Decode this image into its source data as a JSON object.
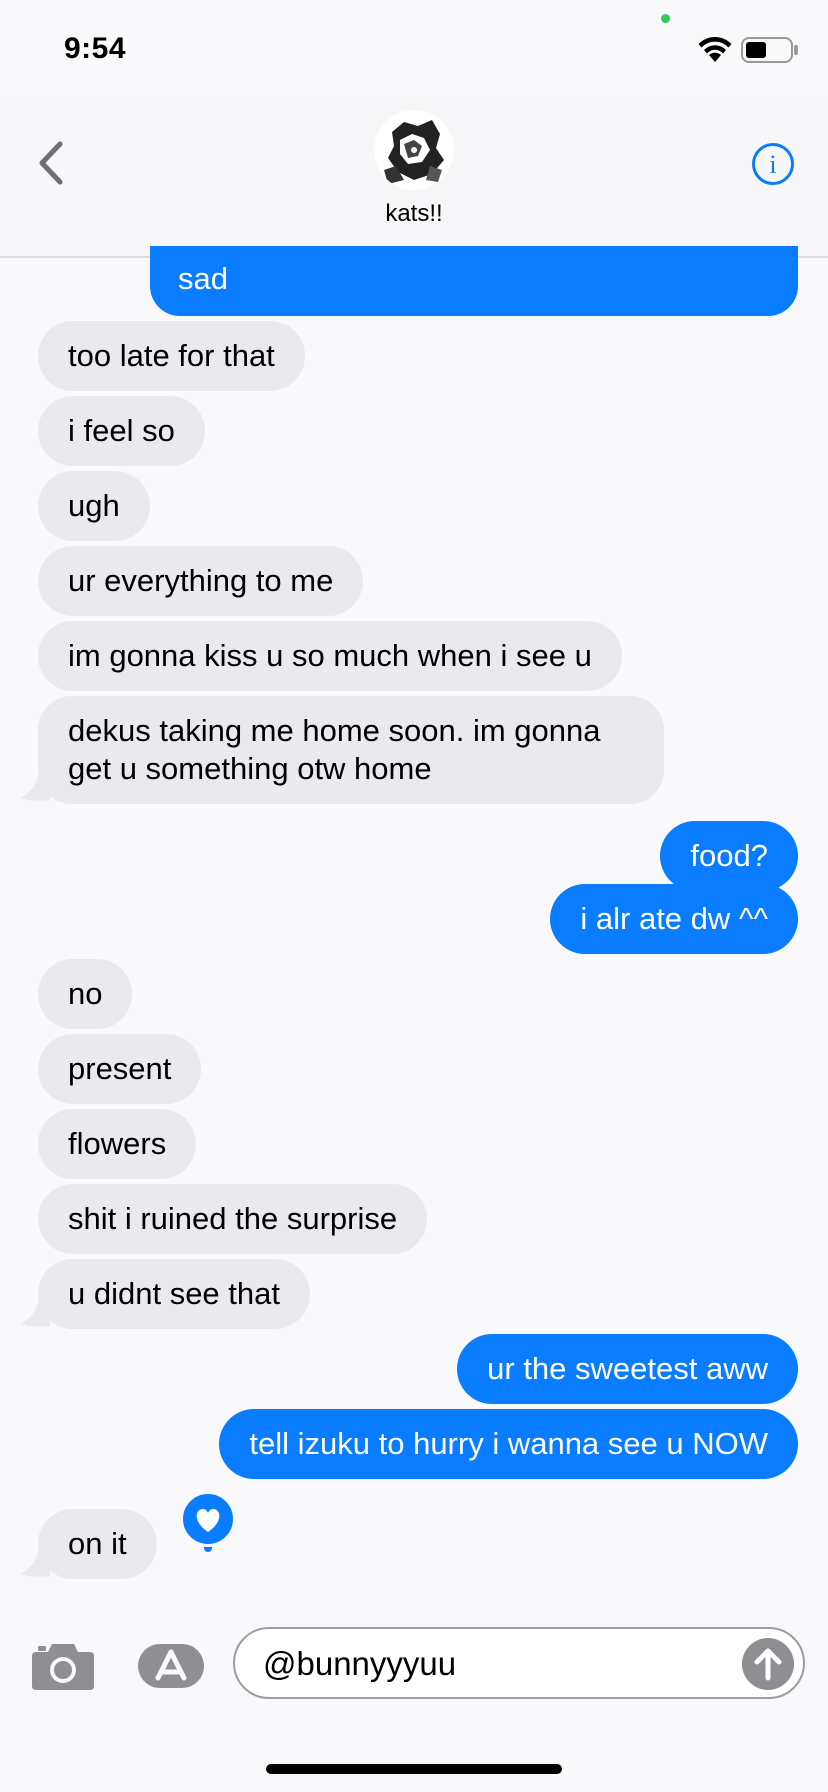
{
  "status_bar": {
    "time": "9:54",
    "camera_indicator_color": "#34c759",
    "icons": [
      "wifi-icon",
      "battery-icon"
    ]
  },
  "header": {
    "contact_name": "kats!!",
    "back_icon": "chevron-left-icon",
    "info_icon": "info-icon",
    "accent_color": "#0a7cff"
  },
  "messages": [
    {
      "side": "sent",
      "text": "sad"
    },
    {
      "side": "received",
      "text": "too late for that"
    },
    {
      "side": "received",
      "text": "i feel so"
    },
    {
      "side": "received",
      "text": "ugh"
    },
    {
      "side": "received",
      "text": "ur everything to me"
    },
    {
      "side": "received",
      "text": "im gonna kiss u so much when i see u"
    },
    {
      "side": "received",
      "text": "dekus taking me home soon. im gonna get u something otw home"
    },
    {
      "side": "sent",
      "text": "food?"
    },
    {
      "side": "sent",
      "text": "i alr ate dw ^^"
    },
    {
      "side": "received",
      "text": "no"
    },
    {
      "side": "received",
      "text": "present"
    },
    {
      "side": "received",
      "text": "flowers"
    },
    {
      "side": "received",
      "text": "shit i ruined the surprise"
    },
    {
      "side": "received",
      "text": "u didnt see that"
    },
    {
      "side": "sent",
      "text": "ur the sweetest aww"
    },
    {
      "side": "sent",
      "text": "tell izuku to hurry i wanna see u NOW"
    },
    {
      "side": "received",
      "text": "on it",
      "tapback": "heart-icon"
    }
  ],
  "input_bar": {
    "value": "@bunnyyyuu",
    "camera_icon": "camera-icon",
    "apps_icon": "app-store-icon",
    "send_icon": "send-arrow-icon"
  },
  "colors": {
    "sent_bubble": "#0a7cff",
    "received_bubble": "#e9e9ee",
    "background": "#f9f9fb"
  }
}
